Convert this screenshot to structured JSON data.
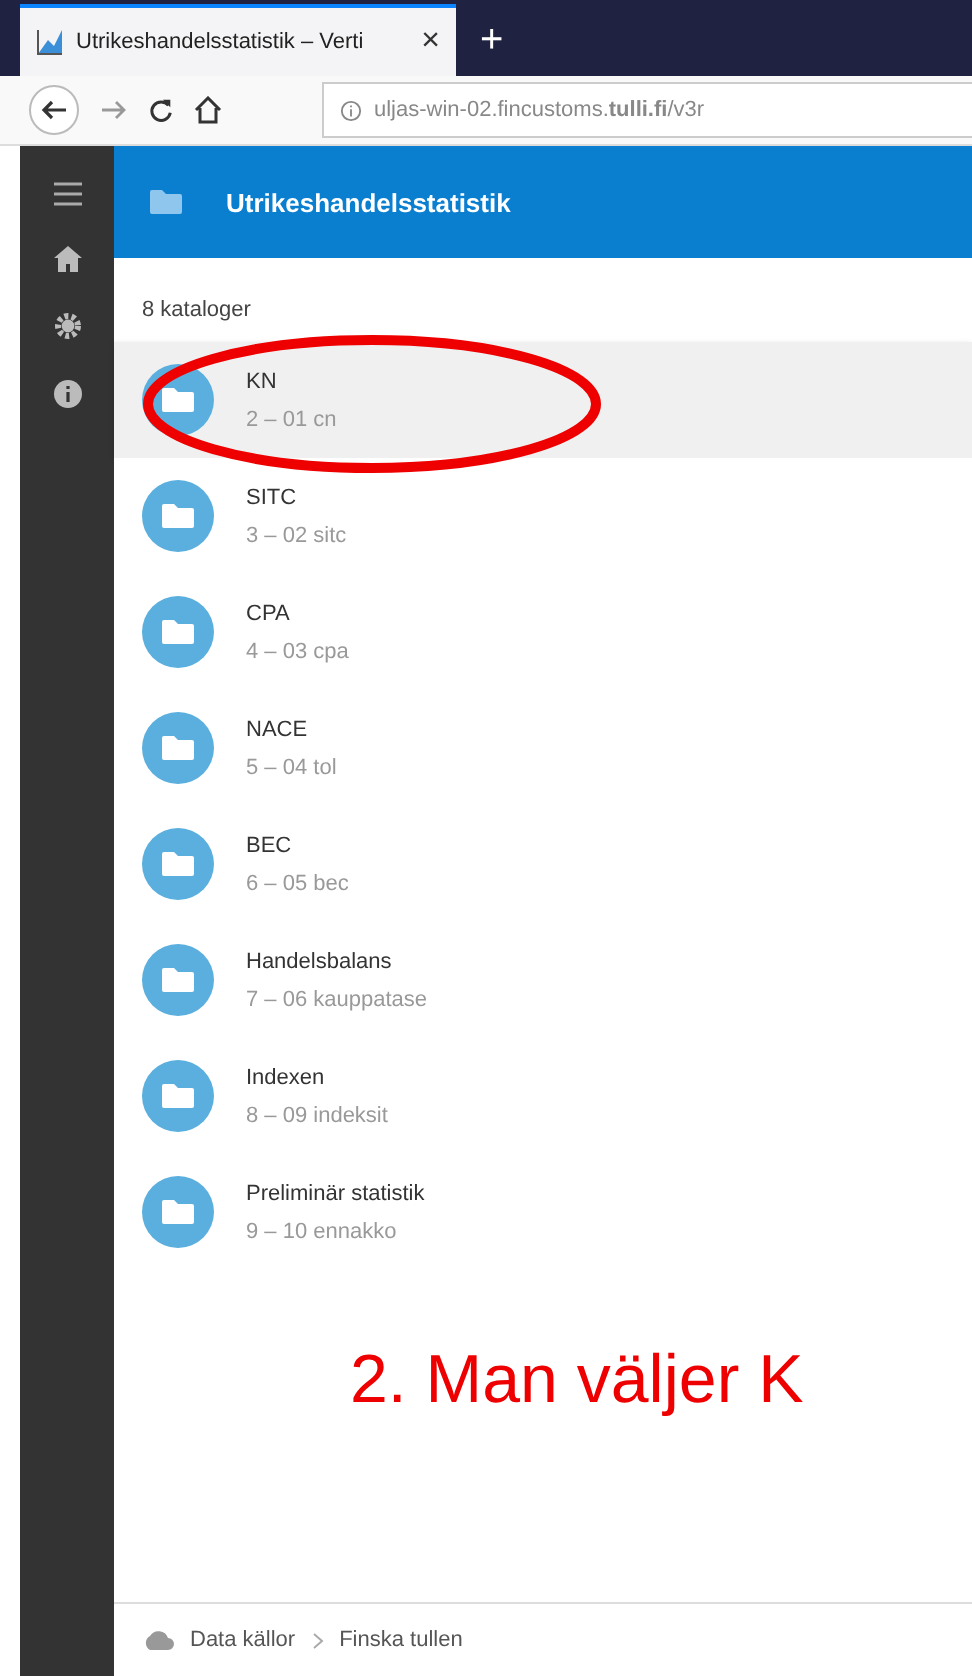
{
  "browser": {
    "tab_title": "Utrikeshandelsstatistik – Verti",
    "tab_close": "×",
    "new_tab": "+",
    "url": "uljas-win-02.fincustoms.**tulli.fi**/v3r"
  },
  "header": {
    "title": "Utrikeshandelsstatistik"
  },
  "count": "8 kataloger",
  "items": [
    {
      "name": "KN",
      "sub": "2 – 01 cn",
      "selected": true
    },
    {
      "name": "SITC",
      "sub": "3 – 02 sitc",
      "selected": false
    },
    {
      "name": "CPA",
      "sub": "4 – 03 cpa",
      "selected": false
    },
    {
      "name": "NACE",
      "sub": "5 – 04 tol",
      "selected": false
    },
    {
      "name": "BEC",
      "sub": "6 – 05 bec",
      "selected": false
    },
    {
      "name": "Handelsbalans",
      "sub": "7 – 06 kauppatase",
      "selected": false
    },
    {
      "name": "Indexen",
      "sub": "8 – 09 indeksit",
      "selected": false
    },
    {
      "name": "Preliminär statistik",
      "sub": "9 – 10 ennakko",
      "selected": false
    }
  ],
  "annotation": "2. Man väljer K",
  "breadcrumb": [
    "Data källor",
    "Finska tullen"
  ]
}
